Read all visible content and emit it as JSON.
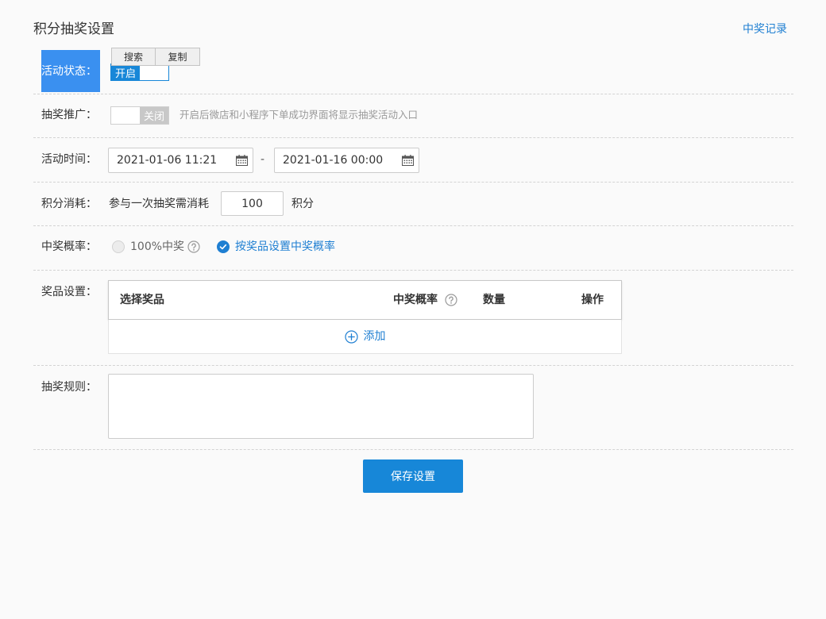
{
  "header": {
    "title": "积分抽奖设置",
    "record_link": "中奖记录"
  },
  "selection_popup": {
    "search_label": "搜索",
    "copy_label": "复制"
  },
  "form": {
    "status": {
      "label": "活动状态：",
      "toggle_text": "开启",
      "on": true
    },
    "promotion": {
      "label": "抽奖推广：",
      "toggle_text": "关闭",
      "on": false,
      "hint": "开启后微店和小程序下单成功界面将显示抽奖活动入口"
    },
    "time": {
      "label": "活动时间：",
      "start": "2021-01-06 11:21",
      "separator": "-",
      "end": "2021-01-16 00:00"
    },
    "points": {
      "label": "积分消耗：",
      "prefix": "参与一次抽奖需消耗",
      "value": "100",
      "suffix": "积分"
    },
    "probability": {
      "label": "中奖概率：",
      "options": [
        {
          "label": "100%中奖",
          "checked": false
        },
        {
          "label": "按奖品设置中奖概率",
          "checked": true
        }
      ]
    },
    "prizes": {
      "label": "奖品设置：",
      "columns": [
        "选择奖品",
        "中奖概率",
        "数量",
        "操作"
      ],
      "add_label": "添加"
    },
    "rules": {
      "label": "抽奖规则：",
      "value": ""
    }
  },
  "actions": {
    "save_label": "保存设置"
  },
  "colors": {
    "primary": "#1787d8",
    "link": "#1f7fd2",
    "selection": "#3a90f0",
    "toggle_off": "#c8c8c8",
    "text": "#333333",
    "hint": "#999999",
    "page_bg": "#fafafa"
  },
  "icons": {
    "calendar": "calendar-icon",
    "help": "question-circle-icon",
    "add": "plus-circle-icon",
    "check": "check-icon"
  }
}
